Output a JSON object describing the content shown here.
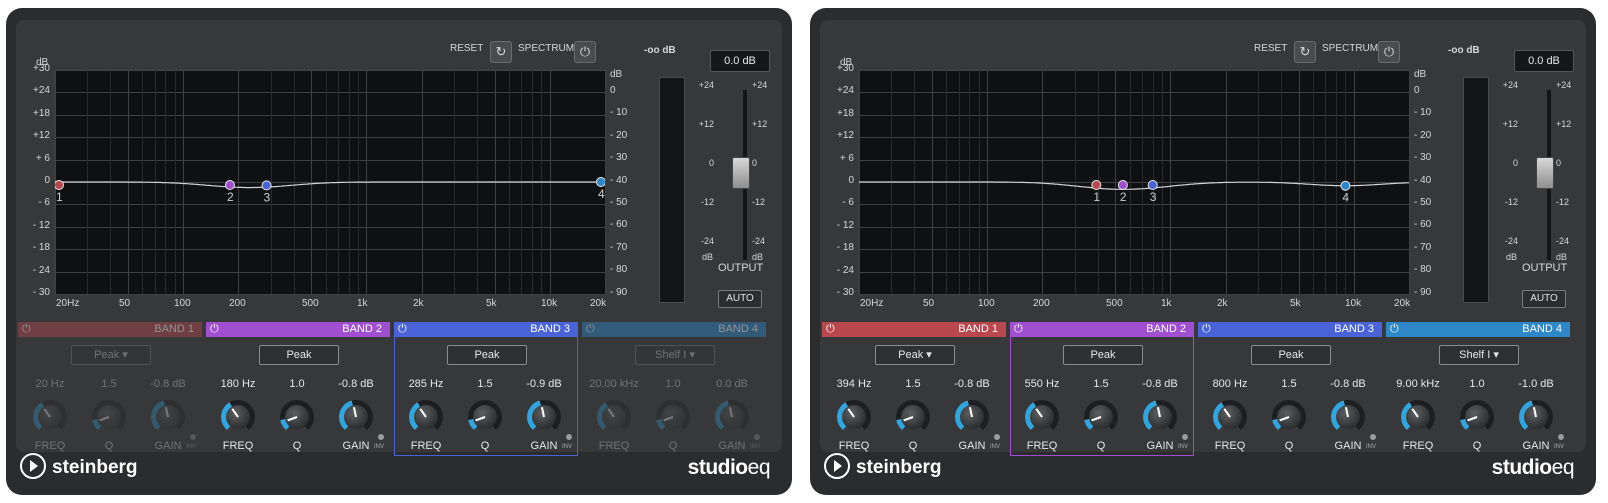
{
  "panels": [
    {
      "reset_label": "RESET",
      "spectrum_label": "SPECTRUM",
      "meter_readout": "-oo dB",
      "output_gain": "0.0 dB",
      "output_label": "OUTPUT",
      "auto_label": "AUTO",
      "selected_band": 2,
      "bands": [
        {
          "label": "BAND 1",
          "type": "Peak",
          "freq": "20 Hz",
          "q": "1.5",
          "gain": "-0.8 dB",
          "enabled": false,
          "color": "#b8484e",
          "point_label": "1",
          "freq_hz": 20,
          "gain_db": -0.8
        },
        {
          "label": "BAND 2",
          "type": "Peak",
          "freq": "180 Hz",
          "q": "1.0",
          "gain": "-0.8 dB",
          "enabled": true,
          "color": "#a14fd1",
          "point_label": "2",
          "freq_hz": 180,
          "gain_db": -0.8
        },
        {
          "label": "BAND 3",
          "type": "Peak",
          "freq": "285 Hz",
          "q": "1.5",
          "gain": "-0.9 dB",
          "enabled": true,
          "color": "#4a63d8",
          "point_label": "3",
          "freq_hz": 285,
          "gain_db": -0.9
        },
        {
          "label": "BAND 4",
          "type": "Shelf I",
          "freq": "20.00 kHz",
          "q": "1.0",
          "gain": "0.0 dB",
          "enabled": false,
          "color": "#2e87c7",
          "point_label": "4",
          "freq_hz": 20000,
          "gain_db": 0.0
        }
      ]
    },
    {
      "reset_label": "RESET",
      "spectrum_label": "SPECTRUM",
      "meter_readout": "-oo dB",
      "output_gain": "0.0 dB",
      "output_label": "OUTPUT",
      "auto_label": "AUTO",
      "selected_band": 1,
      "bands": [
        {
          "label": "BAND 1",
          "type": "Peak",
          "freq": "394 Hz",
          "q": "1.5",
          "gain": "-0.8 dB",
          "enabled": true,
          "color": "#b8484e",
          "point_label": "1",
          "freq_hz": 394,
          "gain_db": -0.8
        },
        {
          "label": "BAND 2",
          "type": "Peak",
          "freq": "550 Hz",
          "q": "1.5",
          "gain": "-0.8 dB",
          "enabled": true,
          "color": "#a14fd1",
          "point_label": "2",
          "freq_hz": 550,
          "gain_db": -0.8
        },
        {
          "label": "BAND 3",
          "type": "Peak",
          "freq": "800 Hz",
          "q": "1.5",
          "gain": "-0.8 dB",
          "enabled": true,
          "color": "#4a63d8",
          "point_label": "3",
          "freq_hz": 800,
          "gain_db": -0.8
        },
        {
          "label": "BAND 4",
          "type": "Shelf I",
          "freq": "9.00 kHz",
          "q": "1.0",
          "gain": "-1.0 dB",
          "enabled": true,
          "color": "#2e87c7",
          "point_label": "4",
          "freq_hz": 9000,
          "gain_db": -1.0
        }
      ]
    }
  ],
  "axes": {
    "gain_unit": "dB",
    "gain_ticks": [
      "+30",
      "+24",
      "+18",
      "+12",
      "+ 6",
      "0",
      "- 6",
      "- 12",
      "- 18",
      "- 24",
      "- 30"
    ],
    "spectrum_unit": "dB",
    "spectrum_ticks": [
      "0",
      "- 10",
      "- 20",
      "- 30",
      "- 40",
      "- 50",
      "- 60",
      "- 70",
      "- 80",
      "- 90"
    ],
    "freq_ticks": [
      "20Hz",
      "50",
      "100",
      "200",
      "500",
      "1k",
      "2k",
      "5k",
      "10k",
      "20k"
    ],
    "freq_tick_values": [
      20,
      50,
      100,
      200,
      500,
      1000,
      2000,
      5000,
      10000,
      20000
    ],
    "fader_ticks": [
      "+24",
      "+12",
      "0",
      "-12",
      "-24"
    ],
    "fader_unit": "dB"
  },
  "knob_labels": {
    "freq": "FREQ",
    "q": "Q",
    "gain": "GAIN",
    "inv": "INV"
  },
  "brand": {
    "logo": "steinberg",
    "product_bold": "studio",
    "product_light": "eq"
  },
  "colors": {
    "curve": "#cfd3da",
    "accent_active_ring": "#2fa6e0"
  }
}
